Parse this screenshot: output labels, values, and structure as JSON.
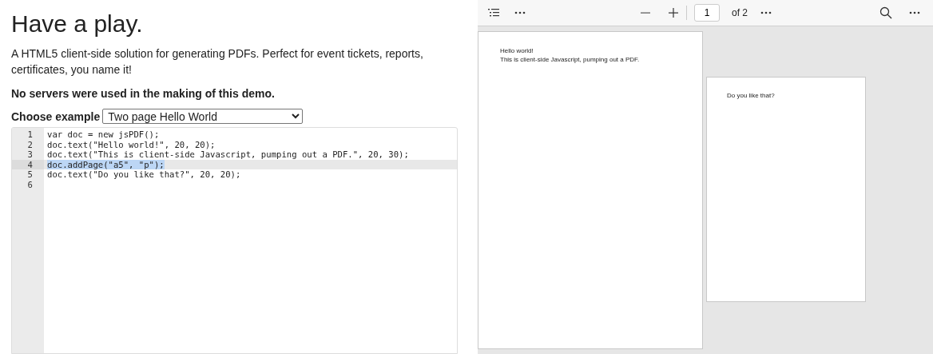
{
  "heading": "Have a play.",
  "intro": "A HTML5 client-side solution for generating PDFs. Perfect for event tickets, reports, certificates, you name it!",
  "note": "No servers were used in the making of this demo.",
  "example": {
    "label": "Choose example",
    "value": "Two page Hello World"
  },
  "editor": {
    "lines": [
      {
        "number": "1",
        "text": "var doc = new jsPDF();",
        "active": false
      },
      {
        "number": "2",
        "text": "doc.text(\"Hello world!\", 20, 20);",
        "active": false
      },
      {
        "number": "3",
        "text": "doc.text(\"This is client-side Javascript, pumping out a PDF.\", 20, 30);",
        "active": false
      },
      {
        "number": "4",
        "text": "doc.addPage(\"a5\", \"p\");",
        "active": true
      },
      {
        "number": "5",
        "text": "doc.text(\"Do you like that?\", 20, 20);",
        "active": false
      },
      {
        "number": "6",
        "active": false
      }
    ]
  },
  "viewer": {
    "page_input": "1",
    "page_count": "of 2",
    "pages": [
      {
        "kind": "a4",
        "lines": [
          "Hello world!",
          "This is client-side Javascript, pumping out a PDF."
        ]
      },
      {
        "kind": "a5",
        "lines": [
          "Do you like that?"
        ]
      }
    ]
  }
}
